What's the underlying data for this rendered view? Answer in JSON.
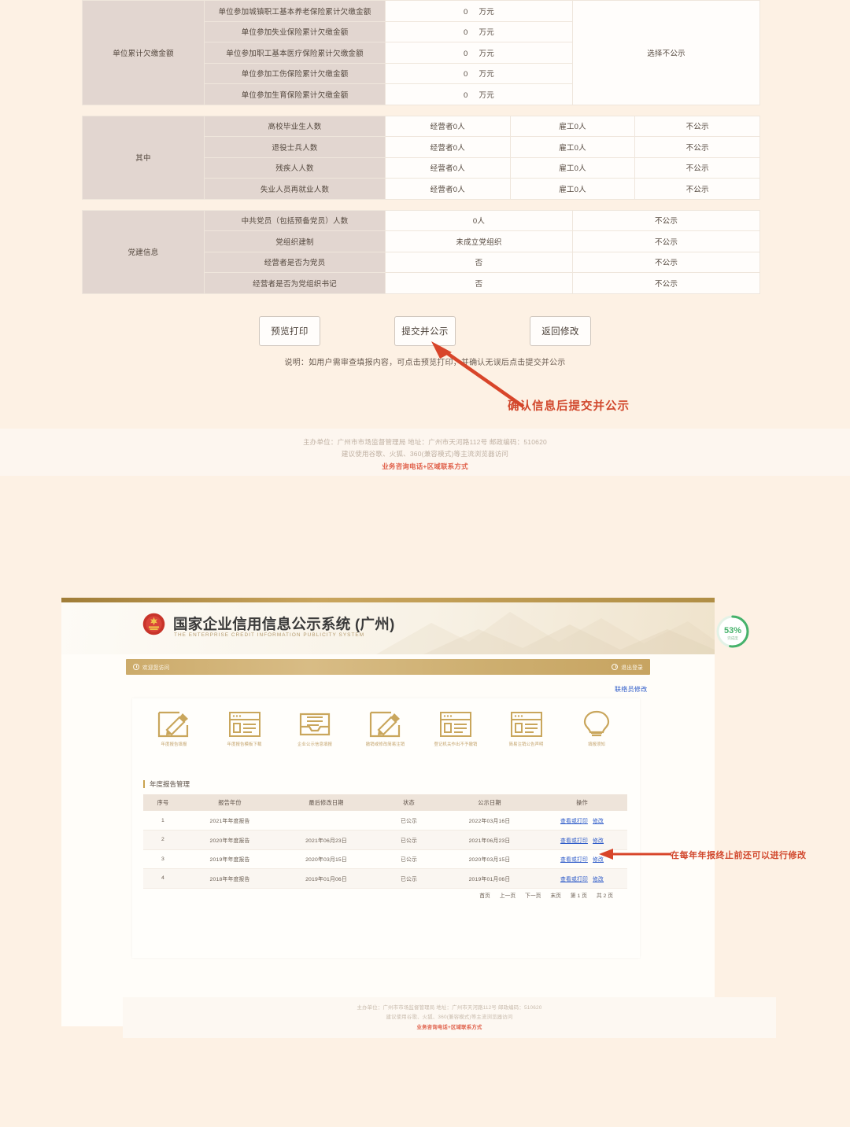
{
  "shot1": {
    "table": {
      "groups": [
        {
          "label": "单位累计欠缴金额",
          "rows": [
            {
              "sub": "单位参加城镇职工基本养老保险累计欠缴金额",
              "value": "0",
              "unit": "万元"
            },
            {
              "sub": "单位参加失业保险累计欠缴金额",
              "value": "0",
              "unit": "万元"
            },
            {
              "sub": "单位参加职工基本医疗保险累计欠缴金额",
              "value": "0",
              "unit": "万元"
            },
            {
              "sub": "单位参加工伤保险累计欠缴金额",
              "value": "0",
              "unit": "万元"
            },
            {
              "sub": "单位参加生育保险累计欠缴金额",
              "value": "0",
              "unit": "万元"
            }
          ],
          "publicity": "选择不公示"
        },
        {
          "label": "其中",
          "rows": [
            {
              "sub": "高校毕业生人数",
              "v1": "经营者0人",
              "v2": "雇工0人",
              "pub": "不公示"
            },
            {
              "sub": "退役士兵人数",
              "v1": "经营者0人",
              "v2": "雇工0人",
              "pub": "不公示"
            },
            {
              "sub": "残疾人人数",
              "v1": "经营者0人",
              "v2": "雇工0人",
              "pub": "不公示"
            },
            {
              "sub": "失业人员再就业人数",
              "v1": "经营者0人",
              "v2": "雇工0人",
              "pub": "不公示"
            }
          ]
        },
        {
          "label": "党建信息",
          "rows": [
            {
              "sub": "中共党员（包括预备党员）人数",
              "v1": "0人",
              "pub": "不公示"
            },
            {
              "sub": "党组织建制",
              "v1": "未成立党组织",
              "pub": "不公示"
            },
            {
              "sub": "经营者是否为党员",
              "v1": "否",
              "pub": "不公示"
            },
            {
              "sub": "经营者是否为党组织书记",
              "v1": "否",
              "pub": "不公示"
            }
          ]
        }
      ]
    },
    "buttons": {
      "preview_print": "预览打印",
      "submit_publish": "提交并公示",
      "back_edit": "返回修改"
    },
    "note": "说明：如用户需审查填报内容，可点击预览打印，并确认无误后点击提交并公示",
    "annotation": "确认信息后提交并公示",
    "footer": {
      "line1": "主办单位：广州市市场监督管理局    地址：广州市天河路112号    邮政编码：510620",
      "line2": "建议使用谷歌、火狐、360(兼容模式)等主流浏览器访问",
      "line3": "业务咨询电话+区域联系方式"
    }
  },
  "shot2": {
    "header": {
      "title": "国家企业信用信息公示系统 (广州)",
      "subtitle": "THE ENTERPRISE CREDIT INFORMATION PUBLICITY SYSTEM",
      "emblem_icon": "national-emblem-icon"
    },
    "nav": {
      "left_label": "欢迎您访问",
      "right_label": "退出登录",
      "left_icon": "clock-icon",
      "right_icon": "exit-icon"
    },
    "badge": {
      "value": "53%",
      "unit": "完成度",
      "color": "#46b26b"
    },
    "top_link": "联络员修改",
    "quick_icons": [
      {
        "name": "年度报告填报",
        "icon": "edit-form-icon"
      },
      {
        "name": "年度报告模板下载",
        "icon": "document-list-icon"
      },
      {
        "name": "企业公示信息填报",
        "icon": "inbox-upload-icon"
      },
      {
        "name": "撤销或修改简易注销",
        "icon": "edit-form-icon"
      },
      {
        "name": "登记机关作出不予撤销",
        "icon": "document-list-icon"
      },
      {
        "name": "简易注销公告声明",
        "icon": "document-list-icon"
      },
      {
        "name": "填报须知",
        "icon": "lightbulb-icon"
      }
    ],
    "section_title": "年度报告管理",
    "table": {
      "columns": [
        "序号",
        "报告年份",
        "最后修改日期",
        "状态",
        "公示日期",
        "操作"
      ],
      "rows": [
        {
          "no": "1",
          "year": "2021年年度报告",
          "modified": "",
          "status": "已公示",
          "published": "2022年03月16日",
          "view": "查看或打印",
          "edit": "修改"
        },
        {
          "no": "2",
          "year": "2020年年度报告",
          "modified": "2021年06月23日",
          "status": "已公示",
          "published": "2021年06月23日",
          "view": "查看或打印",
          "edit": "修改"
        },
        {
          "no": "3",
          "year": "2019年年度报告",
          "modified": "2020年03月15日",
          "status": "已公示",
          "published": "2020年03月15日",
          "view": "查看或打印",
          "edit": "修改"
        },
        {
          "no": "4",
          "year": "2018年年度报告",
          "modified": "2019年01月06日",
          "status": "已公示",
          "published": "2019年01月06日",
          "view": "查看或打印",
          "edit": "修改"
        }
      ]
    },
    "pager": {
      "first": "首页",
      "prev": "上一页",
      "next": "下一页",
      "last": "末页",
      "current": "第 1 页",
      "total": "共 2 页"
    },
    "annotation": "在每年年报终止前还可以进行修改",
    "footer": {
      "line1": "主办单位：广州市市场监督管理局    地址：广州市天河路112号    邮政编码：510620",
      "line2": "建议使用谷歌、火狐、360(兼容模式)等主流浏览器访问",
      "line3": "业务咨询电话+区域联系方式"
    }
  }
}
